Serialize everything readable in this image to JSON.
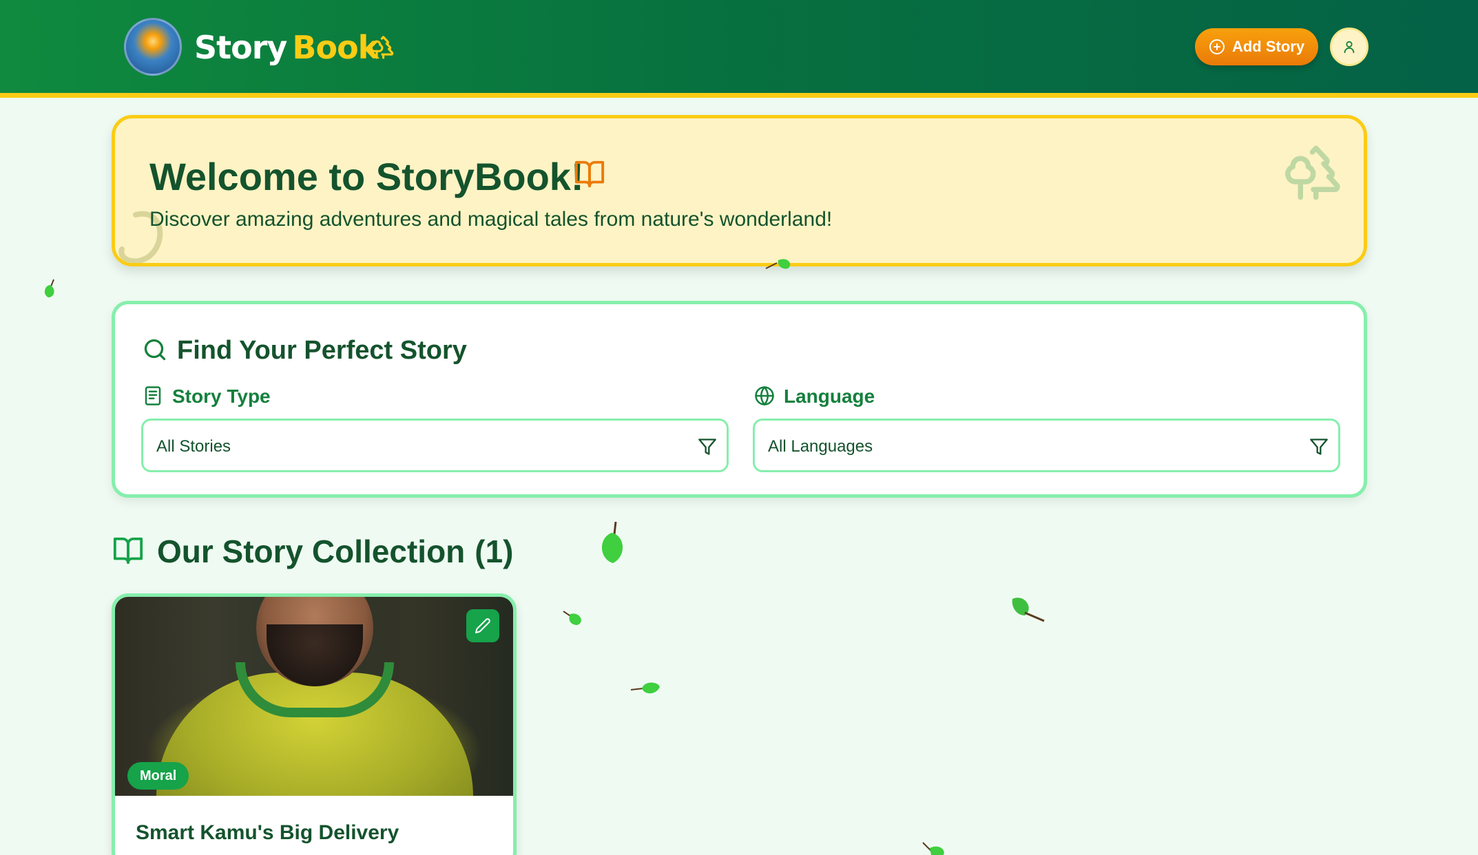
{
  "header": {
    "brand_word1": "Story",
    "brand_word2": "Book",
    "add_story_label": "Add Story"
  },
  "welcome": {
    "title": "Welcome to StoryBook!",
    "subtitle": "Discover amazing adventures and magical tales from nature's wonderland!"
  },
  "search": {
    "title": "Find Your Perfect Story",
    "story_type_label": "Story Type",
    "story_type_value": "All Stories",
    "language_label": "Language",
    "language_value": "All Languages"
  },
  "collection": {
    "title": "Our Story Collection",
    "count": "(1)",
    "stories": [
      {
        "title": "Smart Kamu's Big Delivery",
        "tag": "Moral"
      }
    ]
  },
  "colors": {
    "header_green": "#07703f",
    "accent_yellow": "#facc15",
    "button_orange": "#f59e0b",
    "border_green": "#86efac",
    "text_dark_green": "#14532d"
  },
  "icons": [
    "tree-icon",
    "plus-circle-icon",
    "user-icon",
    "book-open-icon",
    "trees-icon",
    "search-icon",
    "book-icon",
    "globe-icon",
    "filter-icon",
    "pencil-icon",
    "leaf-icon"
  ]
}
